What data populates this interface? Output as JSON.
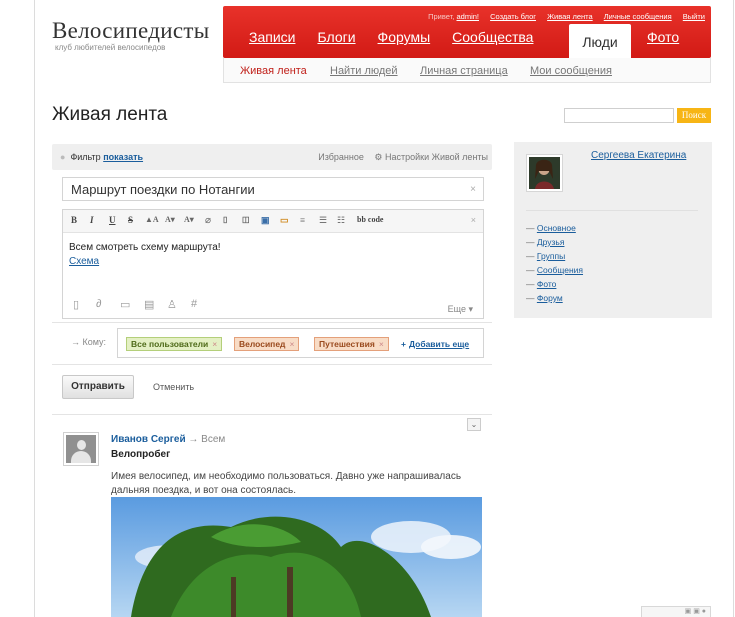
{
  "site": {
    "logo": "Велосипедисты",
    "tagline": "клуб любителей велосипедов"
  },
  "top_links": {
    "greeting": "Привет,",
    "username": "admin!",
    "create_blog": "Создать блог",
    "live_feed": "Живая лента",
    "messages": "Личные сообщения",
    "logout": "Выйти"
  },
  "main_nav": {
    "items": [
      "Записи",
      "Блоги",
      "Форумы",
      "Сообщества"
    ],
    "active": "Люди",
    "last": "Фото"
  },
  "sub_nav": {
    "active": "Живая лента",
    "items": [
      "Найти людей",
      "Личная страница",
      "Мои сообщения"
    ]
  },
  "page": {
    "title": "Живая лента"
  },
  "search": {
    "value": "",
    "button": "Поиск"
  },
  "filter": {
    "label": "Фильтр",
    "toggle": "показать",
    "favorites": "Избранное",
    "settings": "Настройки Живой ленты"
  },
  "composer": {
    "title_value": "Маршрут поездки по Нотангии",
    "clear": "×",
    "toolbar": [
      "B",
      "I",
      "U",
      "S",
      "bb code"
    ],
    "body_text": "Всем смотреть схему маршрута!",
    "body_link": "Схема",
    "more": "Еще",
    "to_label": "Кому:",
    "tags": [
      "Все пользователи",
      "Велосипед",
      "Путешествия"
    ],
    "tag_remove": "×",
    "add_more": "Добавить еще",
    "send": "Отправить",
    "cancel": "Отменить"
  },
  "post": {
    "author": "Иванов Сергей",
    "audience": "Всем",
    "title": "Велопробег",
    "text": "Имея велосипед, им необходимо пользоваться. Давно уже напрашивалась дальняя поездка, и вот она состоялась."
  },
  "sidebar": {
    "name": "Сергеева Екатерина",
    "menu": [
      "Основное",
      "Друзья",
      "Группы",
      "Сообщения",
      "Фото",
      "Форум"
    ]
  },
  "colors": {
    "brand_red": "#d21a15",
    "link": "#1a5d9c",
    "search_button": "#f7b515"
  }
}
